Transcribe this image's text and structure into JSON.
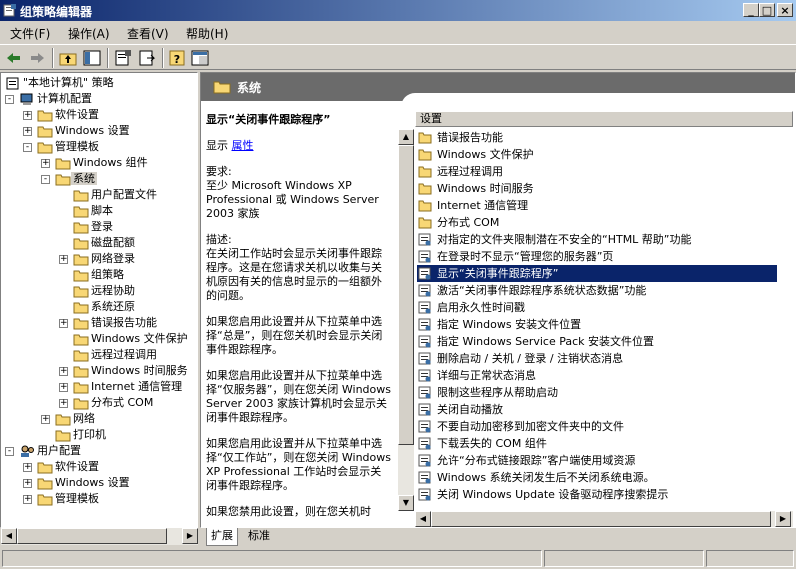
{
  "window": {
    "title": "组策略编辑器"
  },
  "menu": [
    "文件(F)",
    "操作(A)",
    "查看(V)",
    "帮助(H)"
  ],
  "tree": [
    {
      "label": "\"本地计算机\" 策略",
      "level": 0,
      "icon": "policy-icon"
    },
    {
      "label": "计算机配置",
      "level": 1,
      "icon": "computer-icon",
      "expander": "-"
    },
    {
      "label": "软件设置",
      "level": 2,
      "icon": "folder-icon",
      "expander": "+"
    },
    {
      "label": "Windows 设置",
      "level": 2,
      "icon": "folder-icon",
      "expander": "+"
    },
    {
      "label": "管理模板",
      "level": 2,
      "icon": "folder-icon",
      "expander": "-"
    },
    {
      "label": "Windows 组件",
      "level": 3,
      "icon": "folder-icon",
      "expander": "+"
    },
    {
      "label": "系统",
      "level": 3,
      "icon": "folder-open-icon",
      "expander": "-",
      "selected": true
    },
    {
      "label": "用户配置文件",
      "level": 4,
      "icon": "folder-icon"
    },
    {
      "label": "脚本",
      "level": 4,
      "icon": "folder-icon"
    },
    {
      "label": "登录",
      "level": 4,
      "icon": "folder-icon"
    },
    {
      "label": "磁盘配额",
      "level": 4,
      "icon": "folder-icon"
    },
    {
      "label": "网络登录",
      "level": 4,
      "icon": "folder-icon",
      "expander": "+"
    },
    {
      "label": "组策略",
      "level": 4,
      "icon": "folder-icon"
    },
    {
      "label": "远程协助",
      "level": 4,
      "icon": "folder-icon"
    },
    {
      "label": "系统还原",
      "level": 4,
      "icon": "folder-icon"
    },
    {
      "label": "错误报告功能",
      "level": 4,
      "icon": "folder-icon",
      "expander": "+"
    },
    {
      "label": "Windows 文件保护",
      "level": 4,
      "icon": "folder-icon"
    },
    {
      "label": "远程过程调用",
      "level": 4,
      "icon": "folder-icon"
    },
    {
      "label": "Windows 时间服务",
      "level": 4,
      "icon": "folder-icon",
      "expander": "+"
    },
    {
      "label": "Internet 通信管理",
      "level": 4,
      "icon": "folder-icon",
      "expander": "+"
    },
    {
      "label": "分布式 COM",
      "level": 4,
      "icon": "folder-icon",
      "expander": "+"
    },
    {
      "label": "网络",
      "level": 3,
      "icon": "folder-icon",
      "expander": "+"
    },
    {
      "label": "打印机",
      "level": 3,
      "icon": "folder-icon"
    },
    {
      "label": "用户配置",
      "level": 1,
      "icon": "user-icon",
      "expander": "-"
    },
    {
      "label": "软件设置",
      "level": 2,
      "icon": "folder-icon",
      "expander": "+"
    },
    {
      "label": "Windows 设置",
      "level": 2,
      "icon": "folder-icon",
      "expander": "+"
    },
    {
      "label": "管理模板",
      "level": 2,
      "icon": "folder-icon",
      "expander": "+"
    }
  ],
  "right_header": {
    "title": "系统"
  },
  "description": {
    "title": "显示“关闭事件跟踪程序”",
    "display_label": "显示",
    "properties_link": "属性",
    "requirements_label": "要求:",
    "requirements": "至少 Microsoft Windows XP Professional 或 Windows Server 2003 家族",
    "desc_label": "描述:",
    "paragraphs": [
      "在关闭工作站时会显示关闭事件跟踪程序。这是在您请求关机以收集与关机原因有关的信息时显示的一组额外的问题。",
      "如果您启用此设置并从下拉菜单中选择“总是”，则在您关机时会显示关闭事件跟踪程序。",
      "如果您启用此设置并从下拉菜单中选择“仅服务器”，则在您关闭 Windows Server 2003 家族计算机时会显示关闭事件跟踪程序。",
      "如果您启用此设置并从下拉菜单中选择“仅工作站”，则在您关闭 Windows XP Professional 工作站时会显示关闭事件跟踪程序。",
      "如果您禁用此设置，则在您关机时"
    ]
  },
  "list": {
    "header": "设置",
    "items": [
      {
        "label": "错误报告功能",
        "icon": "folder"
      },
      {
        "label": "Windows 文件保护",
        "icon": "folder"
      },
      {
        "label": "远程过程调用",
        "icon": "folder"
      },
      {
        "label": "Windows 时间服务",
        "icon": "folder"
      },
      {
        "label": "Internet 通信管理",
        "icon": "folder"
      },
      {
        "label": "分布式 COM",
        "icon": "folder"
      },
      {
        "label": "对指定的文件夹限制潜在不安全的“HTML 帮助”功能",
        "icon": "setting"
      },
      {
        "label": "在登录时不显示“管理您的服务器”页",
        "icon": "setting"
      },
      {
        "label": "显示“关闭事件跟踪程序”",
        "icon": "setting",
        "selected": true
      },
      {
        "label": "激活“关闭事件跟踪程序系统状态数据”功能",
        "icon": "setting"
      },
      {
        "label": "启用永久性时间戳",
        "icon": "setting"
      },
      {
        "label": "指定 Windows 安装文件位置",
        "icon": "setting"
      },
      {
        "label": "指定 Windows Service Pack 安装文件位置",
        "icon": "setting"
      },
      {
        "label": "删除启动 / 关机 / 登录 / 注销状态消息",
        "icon": "setting"
      },
      {
        "label": "详细与正常状态消息",
        "icon": "setting"
      },
      {
        "label": "限制这些程序从帮助启动",
        "icon": "setting"
      },
      {
        "label": "关闭自动播放",
        "icon": "setting"
      },
      {
        "label": "不要自动加密移到加密文件夹中的文件",
        "icon": "setting"
      },
      {
        "label": "下载丢失的 COM 组件",
        "icon": "setting"
      },
      {
        "label": "允许“分布式链接跟踪”客户端使用域资源",
        "icon": "setting"
      },
      {
        "label": "Windows 系统关闭发生后不关闭系统电源。",
        "icon": "setting"
      },
      {
        "label": "关闭 Windows Update 设备驱动程序搜索提示",
        "icon": "setting"
      }
    ]
  },
  "tabs": [
    "扩展",
    "标准"
  ],
  "colors": {
    "selection": "#0a246a",
    "titlebar_start": "#0a246a",
    "titlebar_end": "#a6caf0",
    "header_band": "#6b6b6b",
    "folder": "#f8d775"
  }
}
